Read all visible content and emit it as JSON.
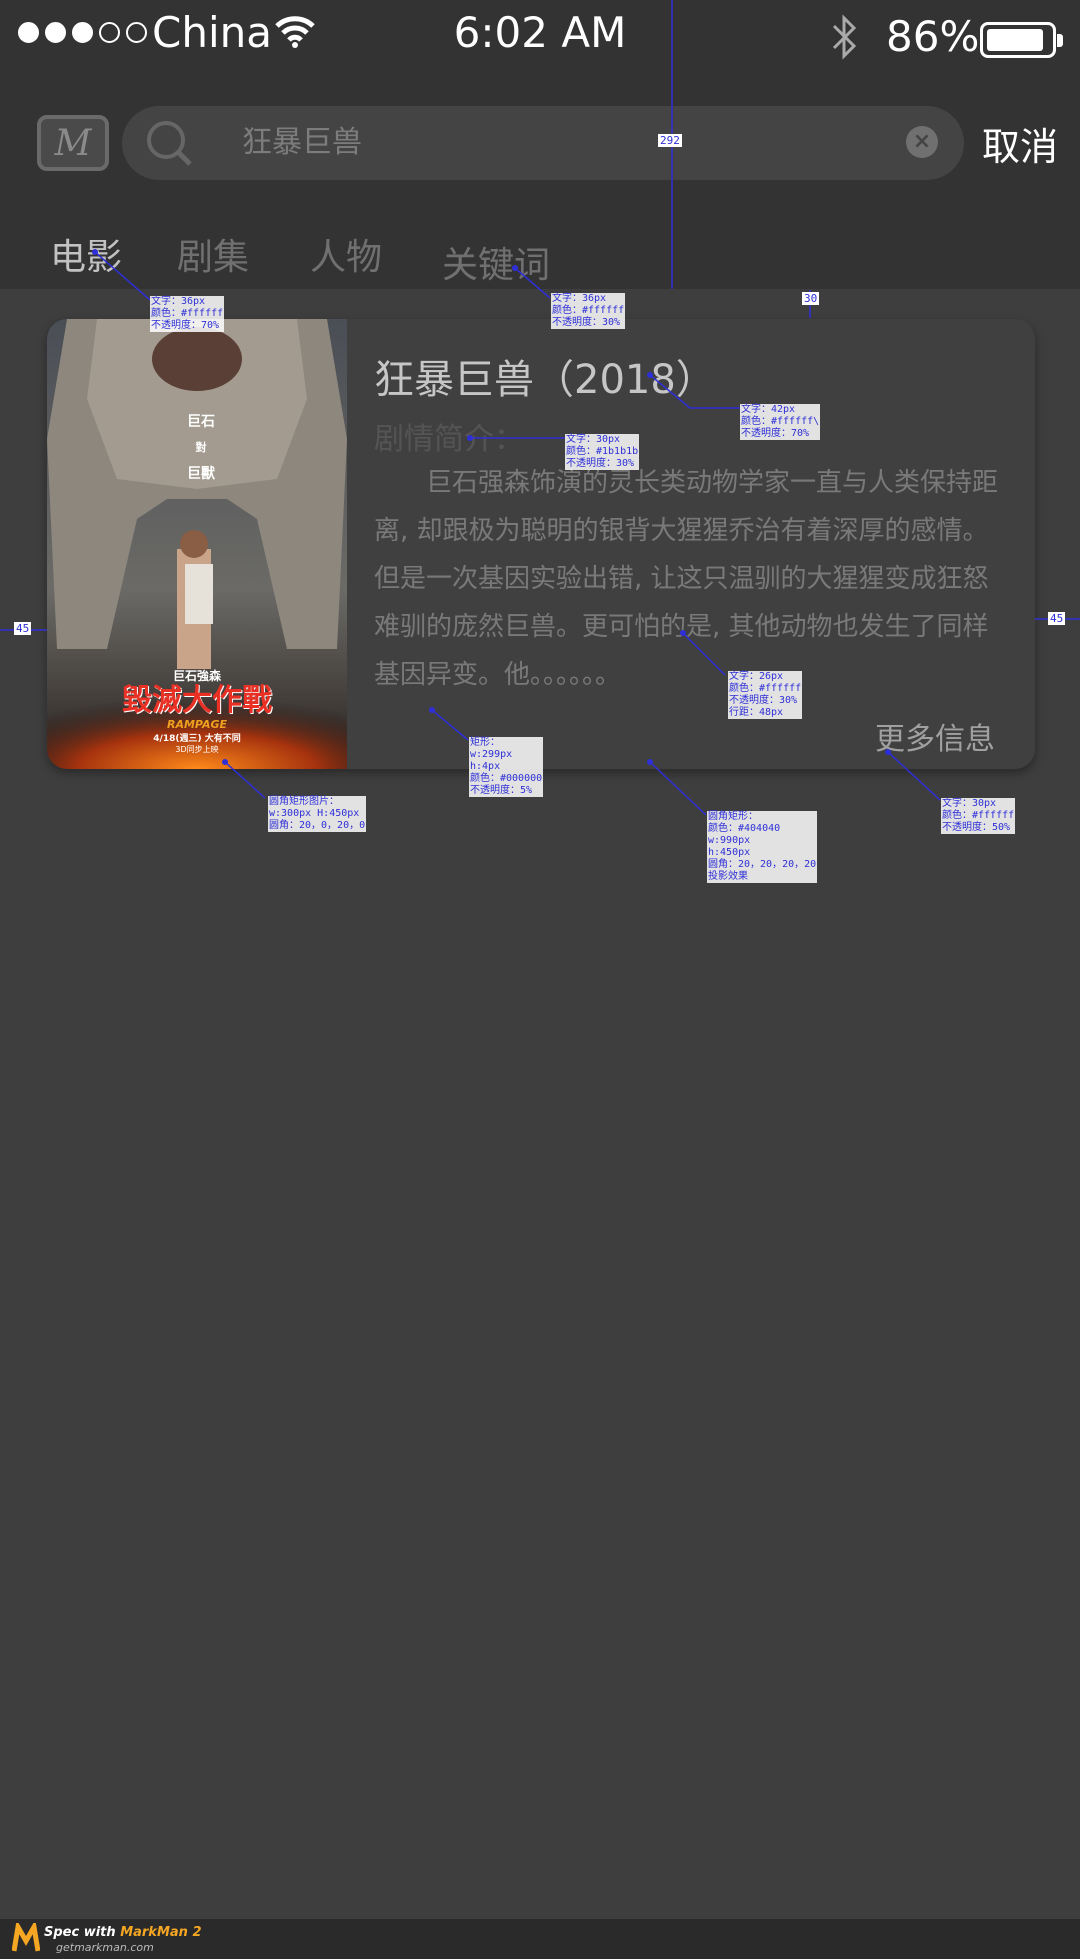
{
  "status_bar": {
    "carrier": "China",
    "time": "6:02 AM",
    "battery": "86%",
    "battery_level": 0.86,
    "signal_bars_on": 3,
    "signal_bars_total": 5
  },
  "search": {
    "logo_letter": "M",
    "query": "狂暴巨兽",
    "cancel": "取消"
  },
  "tabs": [
    {
      "label": "电影",
      "active": true
    },
    {
      "label": "剧集",
      "active": false
    },
    {
      "label": "人物",
      "active": false
    },
    {
      "label": "关键词",
      "active": false
    }
  ],
  "movie": {
    "title": "狂暴巨兽（2018）",
    "subtitle": "剧情简介：",
    "description": "巨石强森饰演的灵长类动物学家一直与人类保持距离, 却跟极为聪明的银背大猩猩乔治有着深厚的感情。但是一次基因实验出错, 让这只温驯的大猩猩变成狂怒难驯的庞然巨兽。更可怕的是, 其他动物也发生了同样基因异变。他。。。。。。",
    "more": "更多信息",
    "poster": {
      "text1": "巨石",
      "text2": "對",
      "text3": "巨獸",
      "actor": "巨石強森",
      "name": "毀滅大作戰",
      "eng": "RAMPAGE",
      "date": "4/18(週三) 大有不同",
      "format": "3D同步上映"
    }
  },
  "annotations": {
    "a1": [
      "文字：36px",
      "颜色：#ffffff",
      "不透明度：70%"
    ],
    "a2": [
      "文字：36px",
      "颜色：#ffffff",
      "不透明度：30%"
    ],
    "a3": [
      "文字：42px",
      "颜色：#ffffff\\",
      "不透明度：70%"
    ],
    "a4": [
      "文字：30px",
      "颜色：#1b1b1b",
      "不透明度：30%"
    ],
    "a5": [
      "文字：26px",
      "颜色：#ffffff",
      "不透明度：30%",
      "行距：48px"
    ],
    "a6": [
      "矩形：",
      "w:299px",
      "h:4px",
      "颜色：#000000",
      "不透明度：5%"
    ],
    "a7": [
      "圆角矩形图片：",
      "w:300px  H:450px",
      "圆角：20，0，20，0"
    ],
    "a8": [
      "圆角矩形：",
      "颜色：#404040",
      "w:990px",
      "h:450px",
      "圆角：20，20，20，20",
      "投影效果"
    ],
    "a9": [
      "文字：30px",
      "颜色：#ffffff",
      "不透明度：50%"
    ],
    "d1": "292",
    "d2": "30",
    "d3": "45",
    "d4": "45"
  },
  "footer": {
    "brand_prefix": "Spec with ",
    "brand_name": "MarkMan 2",
    "site": "getmarkman.com"
  },
  "colors": {
    "header_bg": "#333333",
    "page_bg": "#3e3e3e",
    "card_bg": "#404040",
    "annotation": "#2f2fd8"
  }
}
